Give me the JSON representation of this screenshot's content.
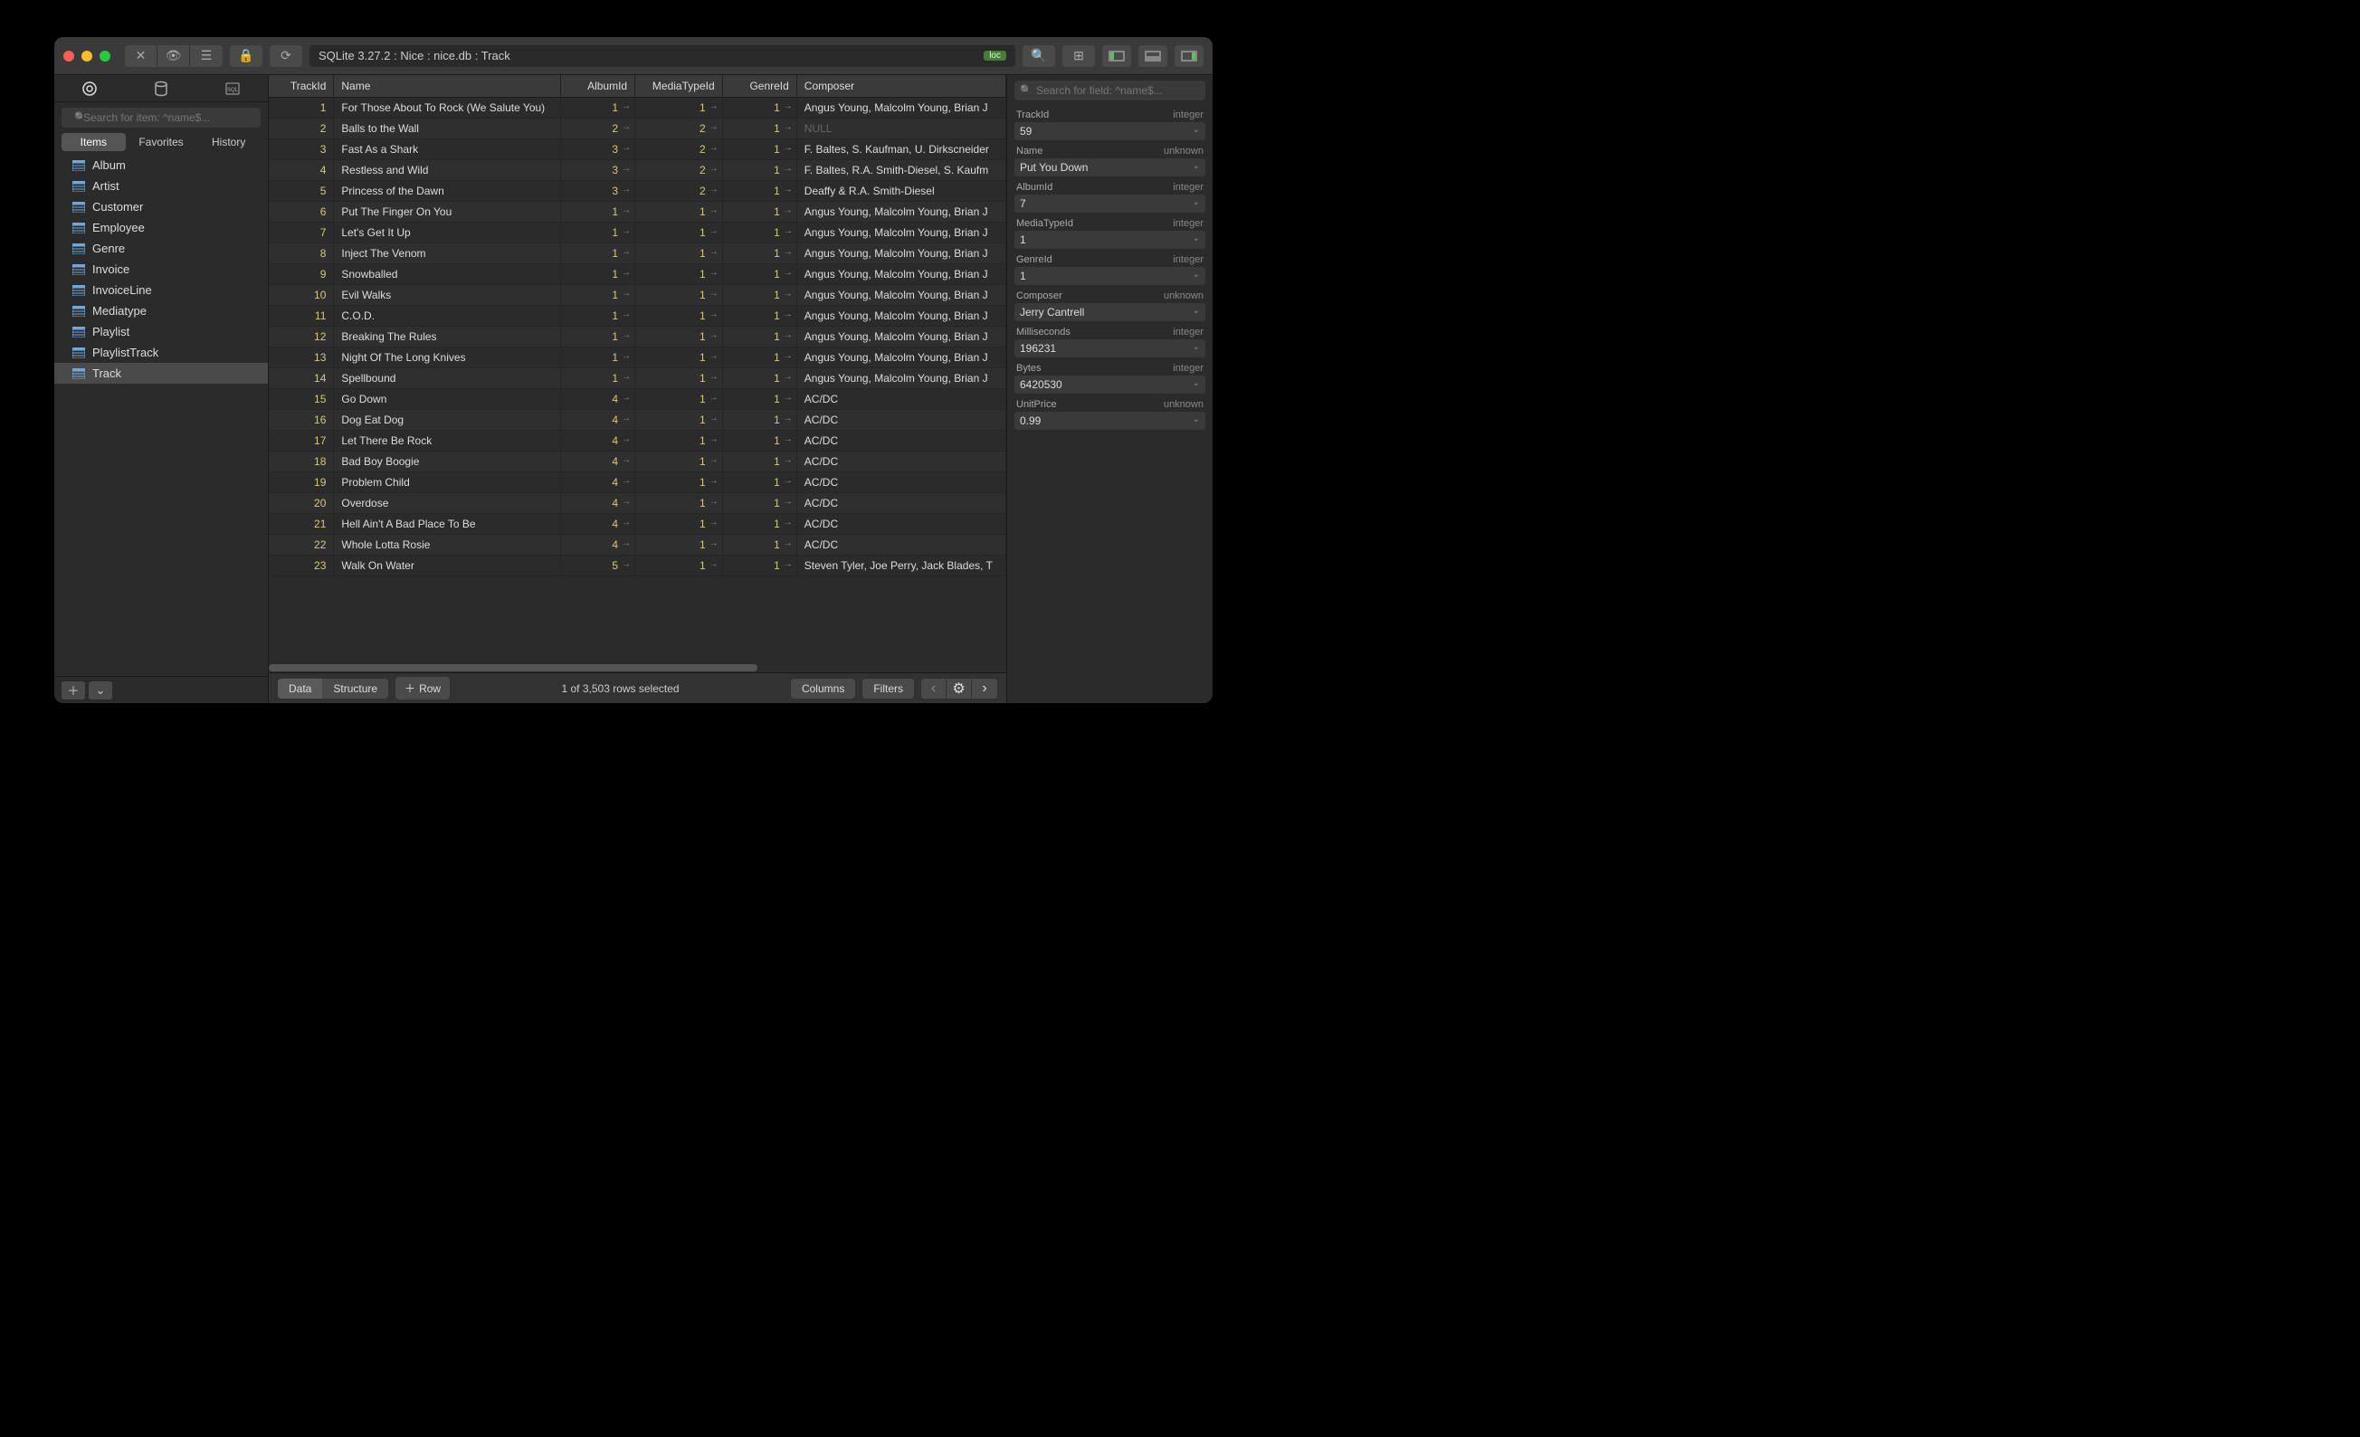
{
  "titlebar": {
    "connection": "SQLite 3.27.2 : Nice : nice.db : Track",
    "loc_badge": "loc"
  },
  "sidebar": {
    "search_placeholder": "Search for item: ^name$...",
    "tabs": [
      {
        "label": "Items",
        "active": true
      },
      {
        "label": "Favorites",
        "active": false
      },
      {
        "label": "History",
        "active": false
      }
    ],
    "items": [
      {
        "label": "Album",
        "selected": false
      },
      {
        "label": "Artist",
        "selected": false
      },
      {
        "label": "Customer",
        "selected": false
      },
      {
        "label": "Employee",
        "selected": false
      },
      {
        "label": "Genre",
        "selected": false
      },
      {
        "label": "Invoice",
        "selected": false
      },
      {
        "label": "InvoiceLine",
        "selected": false
      },
      {
        "label": "Mediatype",
        "selected": false
      },
      {
        "label": "Playlist",
        "selected": false
      },
      {
        "label": "PlaylistTrack",
        "selected": false
      },
      {
        "label": "Track",
        "selected": true
      }
    ]
  },
  "grid": {
    "columns": [
      "TrackId",
      "Name",
      "AlbumId",
      "MediaTypeId",
      "GenreId",
      "Composer"
    ],
    "rows": [
      {
        "TrackId": 1,
        "Name": "For Those About To Rock (We Salute You)",
        "AlbumId": 1,
        "MediaTypeId": 1,
        "GenreId": 1,
        "Composer": "Angus Young, Malcolm Young, Brian J"
      },
      {
        "TrackId": 2,
        "Name": "Balls to the Wall",
        "AlbumId": 2,
        "MediaTypeId": 2,
        "GenreId": 1,
        "Composer": null
      },
      {
        "TrackId": 3,
        "Name": "Fast As a Shark",
        "AlbumId": 3,
        "MediaTypeId": 2,
        "GenreId": 1,
        "Composer": "F. Baltes, S. Kaufman, U. Dirkscneider"
      },
      {
        "TrackId": 4,
        "Name": "Restless and Wild",
        "AlbumId": 3,
        "MediaTypeId": 2,
        "GenreId": 1,
        "Composer": "F. Baltes, R.A. Smith-Diesel, S. Kaufm"
      },
      {
        "TrackId": 5,
        "Name": "Princess of the Dawn",
        "AlbumId": 3,
        "MediaTypeId": 2,
        "GenreId": 1,
        "Composer": "Deaffy & R.A. Smith-Diesel"
      },
      {
        "TrackId": 6,
        "Name": "Put The Finger On You",
        "AlbumId": 1,
        "MediaTypeId": 1,
        "GenreId": 1,
        "Composer": "Angus Young, Malcolm Young, Brian J"
      },
      {
        "TrackId": 7,
        "Name": "Let's Get It Up",
        "AlbumId": 1,
        "MediaTypeId": 1,
        "GenreId": 1,
        "Composer": "Angus Young, Malcolm Young, Brian J"
      },
      {
        "TrackId": 8,
        "Name": "Inject The Venom",
        "AlbumId": 1,
        "MediaTypeId": 1,
        "GenreId": 1,
        "Composer": "Angus Young, Malcolm Young, Brian J"
      },
      {
        "TrackId": 9,
        "Name": "Snowballed",
        "AlbumId": 1,
        "MediaTypeId": 1,
        "GenreId": 1,
        "Composer": "Angus Young, Malcolm Young, Brian J"
      },
      {
        "TrackId": 10,
        "Name": "Evil Walks",
        "AlbumId": 1,
        "MediaTypeId": 1,
        "GenreId": 1,
        "Composer": "Angus Young, Malcolm Young, Brian J"
      },
      {
        "TrackId": 11,
        "Name": "C.O.D.",
        "AlbumId": 1,
        "MediaTypeId": 1,
        "GenreId": 1,
        "Composer": "Angus Young, Malcolm Young, Brian J"
      },
      {
        "TrackId": 12,
        "Name": "Breaking The Rules",
        "AlbumId": 1,
        "MediaTypeId": 1,
        "GenreId": 1,
        "Composer": "Angus Young, Malcolm Young, Brian J"
      },
      {
        "TrackId": 13,
        "Name": "Night Of The Long Knives",
        "AlbumId": 1,
        "MediaTypeId": 1,
        "GenreId": 1,
        "Composer": "Angus Young, Malcolm Young, Brian J"
      },
      {
        "TrackId": 14,
        "Name": "Spellbound",
        "AlbumId": 1,
        "MediaTypeId": 1,
        "GenreId": 1,
        "Composer": "Angus Young, Malcolm Young, Brian J"
      },
      {
        "TrackId": 15,
        "Name": "Go Down",
        "AlbumId": 4,
        "MediaTypeId": 1,
        "GenreId": 1,
        "Composer": "AC/DC"
      },
      {
        "TrackId": 16,
        "Name": "Dog Eat Dog",
        "AlbumId": 4,
        "MediaTypeId": 1,
        "GenreId": 1,
        "Composer": "AC/DC"
      },
      {
        "TrackId": 17,
        "Name": "Let There Be Rock",
        "AlbumId": 4,
        "MediaTypeId": 1,
        "GenreId": 1,
        "Composer": "AC/DC"
      },
      {
        "TrackId": 18,
        "Name": "Bad Boy Boogie",
        "AlbumId": 4,
        "MediaTypeId": 1,
        "GenreId": 1,
        "Composer": "AC/DC"
      },
      {
        "TrackId": 19,
        "Name": "Problem Child",
        "AlbumId": 4,
        "MediaTypeId": 1,
        "GenreId": 1,
        "Composer": "AC/DC"
      },
      {
        "TrackId": 20,
        "Name": "Overdose",
        "AlbumId": 4,
        "MediaTypeId": 1,
        "GenreId": 1,
        "Composer": "AC/DC"
      },
      {
        "TrackId": 21,
        "Name": "Hell Ain't A Bad Place To Be",
        "AlbumId": 4,
        "MediaTypeId": 1,
        "GenreId": 1,
        "Composer": "AC/DC"
      },
      {
        "TrackId": 22,
        "Name": "Whole Lotta Rosie",
        "AlbumId": 4,
        "MediaTypeId": 1,
        "GenreId": 1,
        "Composer": "AC/DC"
      },
      {
        "TrackId": 23,
        "Name": "Walk On Water",
        "AlbumId": 5,
        "MediaTypeId": 1,
        "GenreId": 1,
        "Composer": "Steven Tyler, Joe Perry, Jack Blades, T"
      }
    ]
  },
  "footer": {
    "data_label": "Data",
    "structure_label": "Structure",
    "row_label": "Row",
    "status": "1 of 3,503 rows selected",
    "columns_label": "Columns",
    "filters_label": "Filters"
  },
  "inspector": {
    "search_placeholder": "Search for field: ^name$...",
    "fields": [
      {
        "name": "TrackId",
        "type": "integer",
        "value": "59"
      },
      {
        "name": "Name",
        "type": "unknown",
        "value": "Put You Down"
      },
      {
        "name": "AlbumId",
        "type": "integer",
        "value": "7"
      },
      {
        "name": "MediaTypeId",
        "type": "integer",
        "value": "1"
      },
      {
        "name": "GenreId",
        "type": "integer",
        "value": "1"
      },
      {
        "name": "Composer",
        "type": "unknown",
        "value": "Jerry Cantrell"
      },
      {
        "name": "Milliseconds",
        "type": "integer",
        "value": "196231"
      },
      {
        "name": "Bytes",
        "type": "integer",
        "value": "6420530"
      },
      {
        "name": "UnitPrice",
        "type": "unknown",
        "value": "0.99"
      }
    ]
  }
}
